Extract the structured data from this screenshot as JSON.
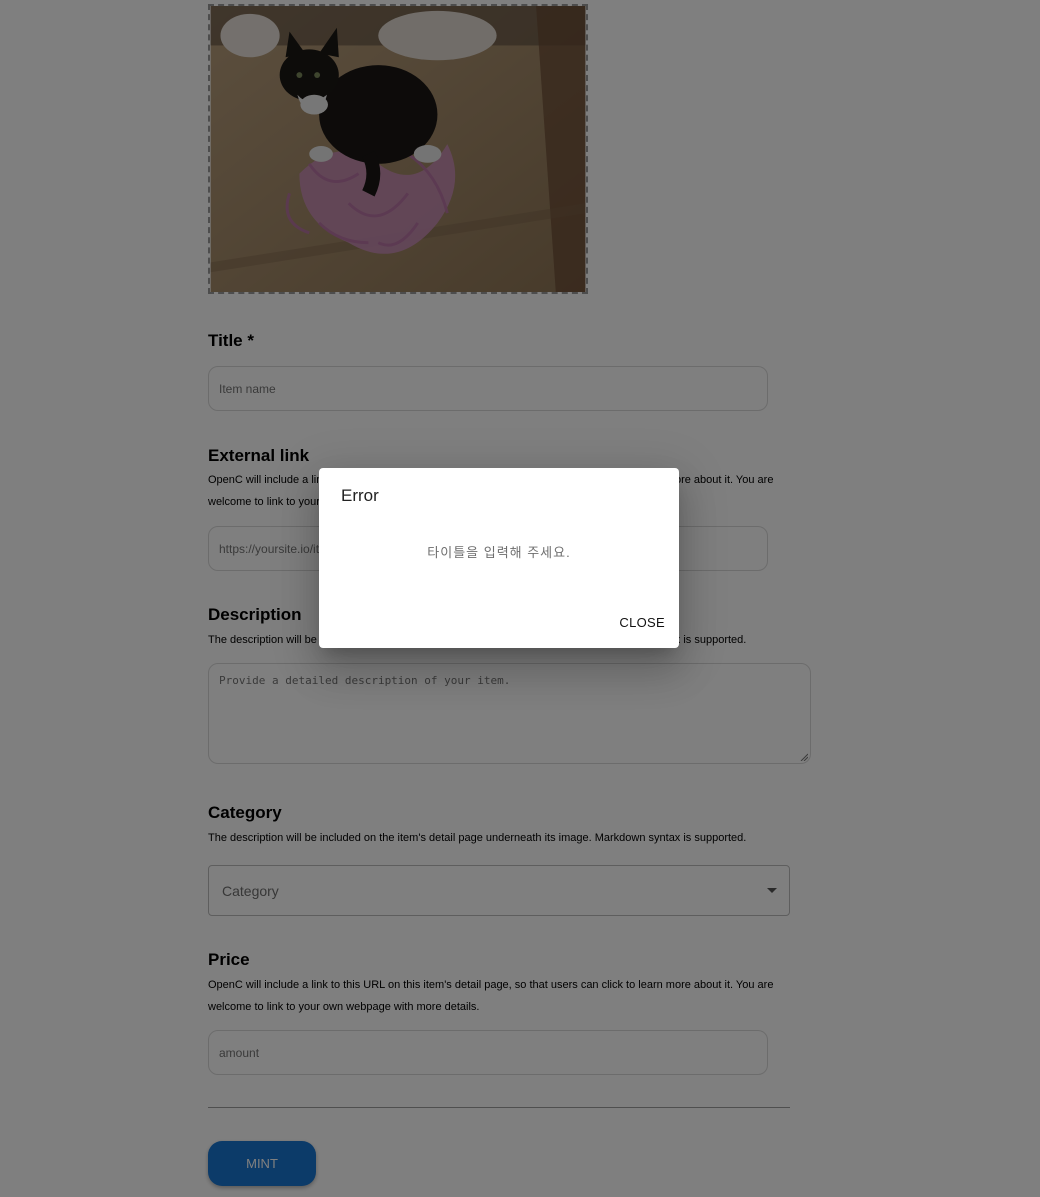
{
  "form": {
    "title": {
      "label": "Title *",
      "placeholder": "Item name"
    },
    "external_link": {
      "label": "External link",
      "help": "OpenC will include a link to this URL on this item's detail page, so that users can click to learn more about it. You are welcome to link to your own webpage with more details.",
      "placeholder": "https://yoursite.io/item/123"
    },
    "description": {
      "label": "Description",
      "help": "The description will be included on the item's detail page underneath its image. Markdown syntax is supported.",
      "placeholder": "Provide a detailed description of your item."
    },
    "category": {
      "label": "Category",
      "help": "The description will be included on the item's detail page underneath its image. Markdown syntax is supported.",
      "placeholder": "Category"
    },
    "price": {
      "label": "Price",
      "help": "OpenC will include a link to this URL on this item's detail page, so that users can click to learn more about it. You are welcome to link to your own webpage with more details.",
      "placeholder": "amount"
    },
    "mint_label": "MINT"
  },
  "dialog": {
    "title": "Error",
    "message": "타이틀을 입력해 주세요.",
    "close_label": "CLOSE"
  },
  "colors": {
    "accent": "#1976d2",
    "backdrop": "rgba(0,0,0,0.5)"
  }
}
